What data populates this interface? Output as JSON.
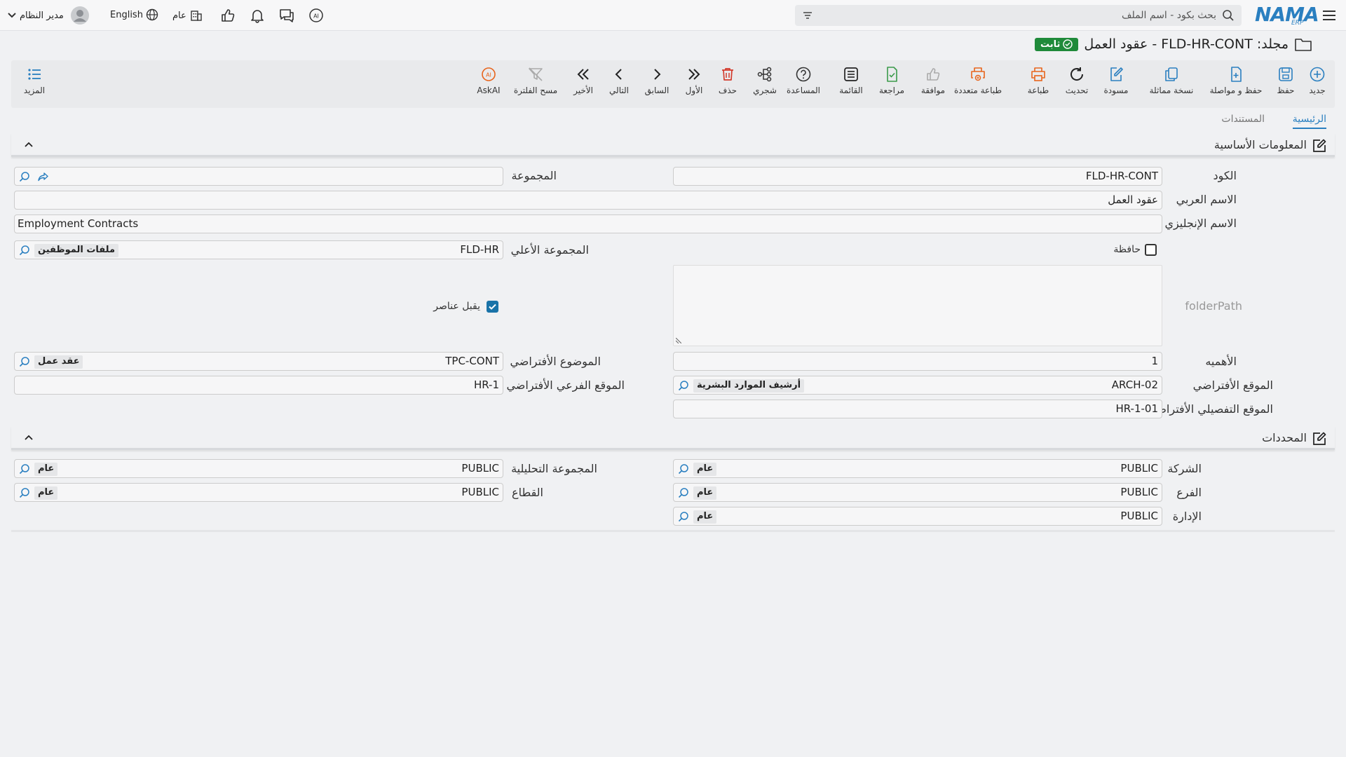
{
  "topbar": {
    "user_name": "مدير النظام",
    "language_label": "English",
    "scope_label": "عام",
    "search_placeholder": "بحث بكود - اسم الملف",
    "logo_text": "NAMA",
    "logo_sub": "ERP"
  },
  "page": {
    "title": "مجلد: FLD-HR-CONT - عقود العمل",
    "status_badge": "ثابت"
  },
  "toolbar": {
    "more": "المزيد",
    "buttons": {
      "new": "جديد",
      "save": "حفظ",
      "save_continue": "حفظ و مواصلة",
      "duplicate": "نسخة مماثلة",
      "draft": "مسودة",
      "refresh": "تحديث",
      "print": "طباعة",
      "multi_print": "طباعة متعددة",
      "approve": "موافقة",
      "review": "مراجعة",
      "list": "القائمة",
      "help": "المساعدة",
      "tree": "شجري",
      "delete": "حذف",
      "first": "الأول",
      "previous": "السابق",
      "next": "التالي",
      "last": "الأخير",
      "clear_filter": "مسح الفلترة",
      "askai": "AskAI"
    }
  },
  "tabs": {
    "main": "الرئيسية",
    "documents": "المستندات"
  },
  "basic_info": {
    "section_title": "المعلومات الأساسية",
    "code_label": "الكود",
    "code_value": "FLD-HR-CONT",
    "group_label": "المجموعة",
    "arabic_name_label": "الاسم العربي",
    "arabic_name_value": "عقود العمل",
    "english_name_label": "الاسم الإنجليزي",
    "english_name_value": "Employment Contracts",
    "keeper_label": "حافظة",
    "parent_group_label": "المجموعة الأعلي",
    "parent_group_code": "FLD-HR",
    "parent_group_name": "ملفات الموظفين",
    "folder_path_label": "folderPath",
    "accepts_items_label": "يقبل عناصر",
    "importance_label": "الأهميه",
    "importance_value": "1",
    "default_topic_label": "الموضوع الأفتراضي",
    "default_topic_code": "TPC-CONT",
    "default_topic_name": "عقد عمل",
    "default_location_label": "الموقع الأفتراضي",
    "default_location_code": "ARCH-02",
    "default_location_name": "أرشيف الموارد البشرية",
    "default_sublocation_label": "الموقع الفرعي الأفتراضي",
    "default_sublocation_value": "HR-1",
    "default_detail_location_label": "الموقع التفصيلي الأفتراضي",
    "default_detail_location_value": "HR-1-01"
  },
  "dimensions": {
    "section_title": "المحددات",
    "company_label": "الشركة",
    "company_code": "PUBLIC",
    "company_name": "عام",
    "analytic_group_label": "المجموعة التحليلية",
    "analytic_group_code": "PUBLIC",
    "analytic_group_name": "عام",
    "branch_label": "الفرع",
    "branch_code": "PUBLIC",
    "branch_name": "عام",
    "sector_label": "القطاع",
    "sector_code": "PUBLIC",
    "sector_name": "عام",
    "department_label": "الإدارة",
    "department_code": "PUBLIC",
    "department_name": "عام"
  },
  "colors": {
    "accent": "#2a7fc0",
    "status_green": "#1f8a3a",
    "print_orange": "#e8641c",
    "delete_red": "#d33a2c",
    "review_green": "#3a9a4a"
  }
}
